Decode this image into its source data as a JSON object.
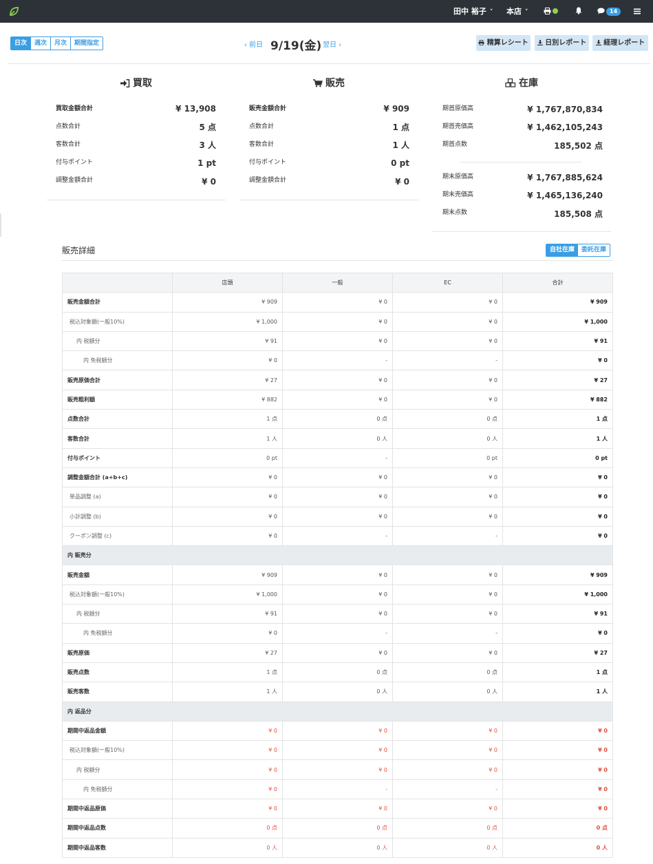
{
  "topbar": {
    "user_name": "田中 裕子",
    "store": "本店",
    "message_count": "14",
    "colors": {
      "bg": "#2d3238",
      "accent": "#3a9ee4",
      "status_dot": "#8fd14f"
    }
  },
  "period_tabs": [
    "日次",
    "週次",
    "月次",
    "期間指定"
  ],
  "date_nav": {
    "prev": "‹ 前日",
    "current": "9/19(金)",
    "next": "翌日 ›"
  },
  "report_buttons": [
    "精算レシート",
    "日別レポート",
    "経理レポート"
  ],
  "kaitori": {
    "title": "買取",
    "rows": [
      {
        "label": "買取金額合計",
        "value": "¥ 13,908"
      },
      {
        "label": "点数合計",
        "value": "5 点"
      },
      {
        "label": "客数合計",
        "value": "3 人"
      },
      {
        "label": "付与ポイント",
        "value": "1 pt"
      },
      {
        "label": "調整金額合計",
        "value": "¥ 0"
      }
    ]
  },
  "hanbai": {
    "title": "販売",
    "rows": [
      {
        "label": "販売金額合計",
        "value": "¥ 909"
      },
      {
        "label": "点数合計",
        "value": "1 点"
      },
      {
        "label": "客数合計",
        "value": "1 人"
      },
      {
        "label": "付与ポイント",
        "value": "0 pt"
      },
      {
        "label": "調整金額合計",
        "value": "¥ 0"
      }
    ]
  },
  "zaiko": {
    "title": "在庫",
    "start_rows": [
      {
        "label": "期首原価高",
        "value": "¥ 1,767,870,834"
      },
      {
        "label": "期首売価高",
        "value": "¥ 1,462,105,243"
      },
      {
        "label": "期首点数",
        "value": "185,502 点"
      }
    ],
    "end_rows": [
      {
        "label": "期末原価高",
        "value": "¥ 1,767,885,624"
      },
      {
        "label": "期末売価高",
        "value": "¥ 1,465,136,240"
      },
      {
        "label": "期末点数",
        "value": "185,508 点"
      }
    ]
  },
  "detail": {
    "title": "販売詳細",
    "toggle": [
      "自社在庫",
      "委託在庫"
    ],
    "headers": [
      "",
      "店頭",
      "一般",
      "EC",
      "合計"
    ],
    "rows": [
      {
        "style": "bold",
        "cells": [
          "販売金額合計",
          "¥ 909",
          "¥ 0",
          "¥ 0",
          "¥ 909"
        ]
      },
      {
        "style": "lvl1",
        "cells": [
          "税込対象額(一般10%)",
          "¥ 1,000",
          "¥ 0",
          "¥ 0",
          "¥ 1,000"
        ]
      },
      {
        "style": "lvl2",
        "cells": [
          "内 税額分",
          "¥ 91",
          "¥ 0",
          "¥ 0",
          "¥ 91"
        ]
      },
      {
        "style": "lvl3",
        "cells": [
          "内 免税額分",
          "¥ 0",
          "-",
          "-",
          "¥ 0"
        ]
      },
      {
        "style": "bold",
        "cells": [
          "販売原価合計",
          "¥ 27",
          "¥ 0",
          "¥ 0",
          "¥ 27"
        ]
      },
      {
        "style": "bold",
        "cells": [
          "販売粗利額",
          "¥ 882",
          "¥ 0",
          "¥ 0",
          "¥ 882"
        ]
      },
      {
        "style": "bold",
        "cells": [
          "点数合計",
          "1 点",
          "0 点",
          "0 点",
          "1 点"
        ]
      },
      {
        "style": "bold",
        "cells": [
          "客数合計",
          "1 人",
          "0 人",
          "0 人",
          "1 人"
        ]
      },
      {
        "style": "bold",
        "cells": [
          "付与ポイント",
          "0 pt",
          "-",
          "0 pt",
          "0 pt"
        ]
      },
      {
        "style": "bold",
        "cells": [
          "調整金額合計 (a+b+c)",
          "¥ 0",
          "¥ 0",
          "¥ 0",
          "¥ 0"
        ]
      },
      {
        "style": "lvl1",
        "cells": [
          "単品調整 (a)",
          "¥ 0",
          "¥ 0",
          "¥ 0",
          "¥ 0"
        ]
      },
      {
        "style": "lvl1",
        "cells": [
          "小計調整 (b)",
          "¥ 0",
          "¥ 0",
          "¥ 0",
          "¥ 0"
        ]
      },
      {
        "style": "lvl1",
        "cells": [
          "クーポン調整 (c)",
          "¥ 0",
          "-",
          "-",
          "¥ 0"
        ]
      },
      {
        "style": "group",
        "cells": [
          "内 販売分"
        ]
      },
      {
        "style": "bold",
        "cells": [
          "販売金額",
          "¥ 909",
          "¥ 0",
          "¥ 0",
          "¥ 909"
        ]
      },
      {
        "style": "lvl1",
        "cells": [
          "税込対象額(一般10%)",
          "¥ 1,000",
          "¥ 0",
          "¥ 0",
          "¥ 1,000"
        ]
      },
      {
        "style": "lvl2",
        "cells": [
          "内 税額分",
          "¥ 91",
          "¥ 0",
          "¥ 0",
          "¥ 91"
        ]
      },
      {
        "style": "lvl3",
        "cells": [
          "内 免税額分",
          "¥ 0",
          "-",
          "-",
          "¥ 0"
        ]
      },
      {
        "style": "bold",
        "cells": [
          "販売原価",
          "¥ 27",
          "¥ 0",
          "¥ 0",
          "¥ 27"
        ]
      },
      {
        "style": "bold",
        "cells": [
          "販売点数",
          "1 点",
          "0 点",
          "0 点",
          "1 点"
        ]
      },
      {
        "style": "bold",
        "cells": [
          "販売客数",
          "1 人",
          "0 人",
          "0 人",
          "1 人"
        ]
      },
      {
        "style": "group",
        "cells": [
          "内 返品分"
        ]
      },
      {
        "style": "bold red",
        "cells": [
          "期間中返品金額",
          "¥ 0",
          "¥ 0",
          "¥ 0",
          "¥ 0"
        ]
      },
      {
        "style": "lvl1 red",
        "cells": [
          "税込対象額(一般10%)",
          "¥ 0",
          "¥ 0",
          "¥ 0",
          "¥ 0"
        ]
      },
      {
        "style": "lvl2 red",
        "cells": [
          "内 税額分",
          "¥ 0",
          "¥ 0",
          "¥ 0",
          "¥ 0"
        ]
      },
      {
        "style": "lvl3 red",
        "cells": [
          "内 免税額分",
          "¥ 0",
          "-",
          "-",
          "¥ 0"
        ]
      },
      {
        "style": "bold red",
        "cells": [
          "期間中返品原価",
          "¥ 0",
          "¥ 0",
          "¥ 0",
          "¥ 0"
        ]
      },
      {
        "style": "bold red",
        "cells": [
          "期間中返品点数",
          "0 点",
          "0 点",
          "0 点",
          "0 点"
        ]
      },
      {
        "style": "bold red",
        "cells": [
          "期間中返品客数",
          "0 人",
          "0 人",
          "0 人",
          "0 人"
        ]
      }
    ]
  }
}
